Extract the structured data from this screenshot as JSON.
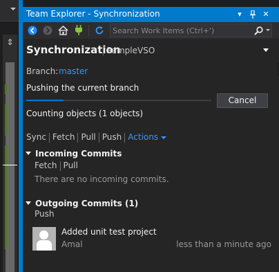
{
  "window": {
    "title": "Team Explorer - Synchronization",
    "title_buttons": [
      "▾",
      "📌",
      "✕"
    ],
    "accent_color": "#007acc"
  },
  "toolbar": {
    "icons": [
      "back-arrow-icon",
      "forward-arrow-icon",
      "home-icon",
      "plug-icon",
      "refresh-icon"
    ],
    "search_placeholder": "Search Work Items (Ctrl+')"
  },
  "page": {
    "title": "Synchronization",
    "repo": "SampleVSO",
    "branch_label": "Branch:",
    "branch": "master"
  },
  "progress": {
    "label": "Pushing the current branch",
    "fraction": 0.2,
    "cancel_label": "Cancel",
    "status": "Counting objects (1 objects)"
  },
  "actions": {
    "items": [
      "Sync",
      "Fetch",
      "Pull",
      "Push"
    ],
    "menu_label": "Actions"
  },
  "incoming": {
    "title": "Incoming Commits",
    "links": [
      "Fetch",
      "Pull"
    ],
    "empty_message": "There are no incoming commits."
  },
  "outgoing": {
    "title": "Outgoing Commits (1)",
    "links": [
      "Push"
    ],
    "commits": [
      {
        "message": "Added unit test project",
        "author": "Amal",
        "time": "less than a minute ago"
      }
    ]
  }
}
